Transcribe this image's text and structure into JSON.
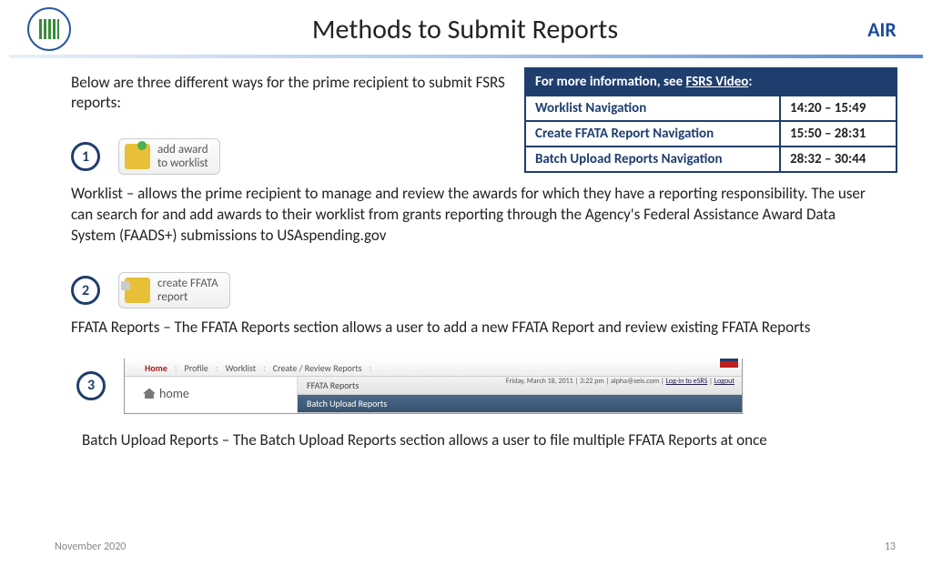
{
  "title": "Methods to Submit Reports",
  "intro": "Below are three different ways for the prime recipient to submit FSRS reports:",
  "info": {
    "header_prefix": "For more information, see ",
    "header_link": "FSRS Video",
    "header_suffix": ":",
    "rows": [
      {
        "label": "Worklist Navigation",
        "time": "14:20 – 15:49"
      },
      {
        "label": "Create FFATA Report Navigation",
        "time": "15:50 – 28:31"
      },
      {
        "label": "Batch Upload Reports Navigation",
        "time": "28:32 – 30:44"
      }
    ]
  },
  "steps": [
    {
      "num": "1",
      "btn_line1": "add award",
      "btn_line2": "to worklist",
      "desc": "Worklist – allows the prime recipient to manage and review the awards for which they have a reporting responsibility. The user can search for and add awards to their worklist from grants reporting through the Agency's Federal Assistance Award Data System (FAADS+) submissions to USAspending.gov"
    },
    {
      "num": "2",
      "btn_line1": "create FFATA",
      "btn_line2": "report",
      "desc": "FFATA Reports – The FFATA Reports section allows a user to add a new FFATA Report and review existing FFATA Reports"
    },
    {
      "num": "3",
      "desc": "Batch Upload Reports – The Batch Upload Reports section allows a user to file multiple FFATA Reports at once"
    }
  ],
  "navshot": {
    "top": {
      "home": "Home",
      "profile": "Profile",
      "worklist": "Worklist",
      "create": "Create / Review Reports"
    },
    "left": "home",
    "tab1": "FFATA Reports",
    "tab2": "Batch Upload Reports",
    "status_date": "Friday, March 18, 2011 | 3:22 pm |",
    "status_user": "alpha@seis.com",
    "status_sep": " | ",
    "status_login": "Log-in to eSRS",
    "status_logout": "Logout"
  },
  "logo_right_text": "AIR",
  "footer": {
    "date": "November 2020",
    "page": "13"
  }
}
